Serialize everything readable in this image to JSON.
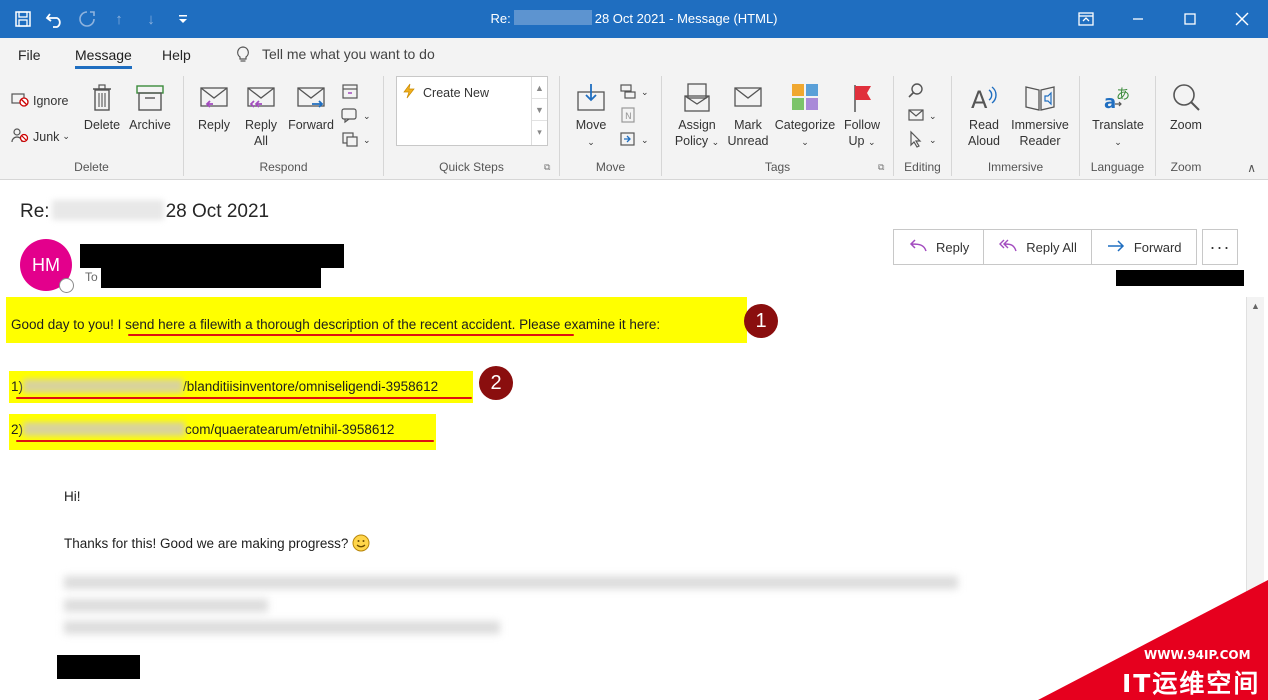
{
  "window": {
    "title_prefix": "Re:",
    "title_suffix": "28 Oct 2021  -  Message (HTML)"
  },
  "menu": {
    "tabs": [
      "File",
      "Message",
      "Help"
    ],
    "tell_me": "Tell me what you want to do"
  },
  "ribbon": {
    "delete": {
      "ignore": "Ignore",
      "junk": "Junk",
      "delete": "Delete",
      "archive": "Archive",
      "label": "Delete"
    },
    "respond": {
      "reply": "Reply",
      "reply_all_1": "Reply",
      "reply_all_2": "All",
      "forward": "Forward",
      "label": "Respond"
    },
    "quick_steps": {
      "create_new": "Create New",
      "label": "Quick Steps"
    },
    "move": {
      "move": "Move",
      "label": "Move"
    },
    "tags": {
      "assign_1": "Assign",
      "assign_2": "Policy",
      "mark_1": "Mark",
      "mark_2": "Unread",
      "categorize": "Categorize",
      "follow_1": "Follow",
      "follow_2": "Up",
      "label": "Tags"
    },
    "editing": {
      "label": "Editing"
    },
    "immersive": {
      "read_1": "Read",
      "read_2": "Aloud",
      "immersive_1": "Immersive",
      "immersive_2": "Reader",
      "label": "Immersive"
    },
    "language": {
      "translate": "Translate",
      "label": "Language"
    },
    "zoom": {
      "zoom": "Zoom",
      "label": "Zoom"
    }
  },
  "message": {
    "subject_prefix": "Re:",
    "subject_suffix": "28 Oct 2021",
    "avatar_initials": "HM",
    "to_label": "To",
    "actions": {
      "reply": "Reply",
      "reply_all": "Reply All",
      "forward": "Forward",
      "more": "···"
    }
  },
  "body": {
    "line1_a": "Good day to you! ",
    "line1_b": "I send here a filewith a thorough description of the recent accident.",
    "line1_c": " Please examine it here:",
    "link1_prefix": "1)",
    "link1_path": "/blanditiisinventore/omniseligendi-3958612",
    "link2_prefix": "2)",
    "link2_path": "com/quaeratearum/etnihil-3958612",
    "badge1": "1",
    "badge2": "2",
    "quoted_hi": "Hi!",
    "quoted_thanks": "Thanks for this! Good we are making progress? "
  },
  "watermark": {
    "url": "WWW.94IP.COM",
    "brand": "IT运维空间"
  },
  "colors": {
    "titlebar": "#1f6ec0",
    "avatar": "#e3008c",
    "highlight": "#ffff00",
    "underline": "#dd1111",
    "badge": "#8a0e0e",
    "watermark": "#e6001e"
  }
}
